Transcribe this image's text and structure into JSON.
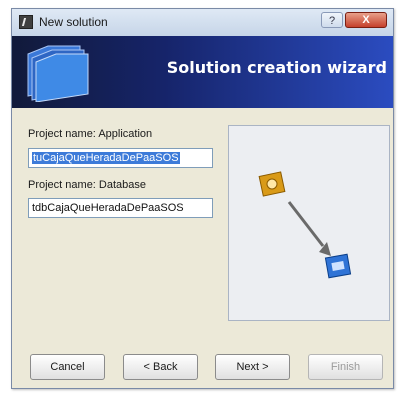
{
  "window": {
    "title": "New solution",
    "help_label": "?",
    "close_label": "X"
  },
  "banner": {
    "title": "Solution creation wizard"
  },
  "form": {
    "app_label": "Project name: Application",
    "app_value": "tuCajaQueHeradaDePaaSOS",
    "db_label": "Project name: Database",
    "db_value": "tdbCajaQueHeradaDePaaSOS"
  },
  "buttons": {
    "cancel": "Cancel",
    "back": "< Back",
    "next": "Next >",
    "finish": "Finish"
  },
  "icons": {
    "window": "app-icon",
    "banner": "folder-stack-icon",
    "app": "application-gear-icon",
    "db": "database-icon",
    "arrow": "arrow-icon"
  }
}
